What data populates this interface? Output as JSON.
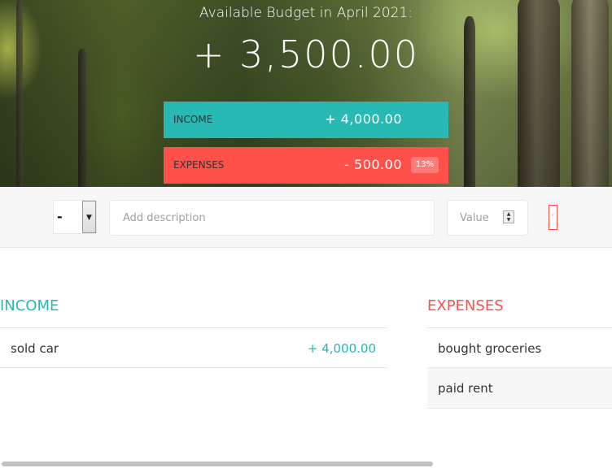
{
  "header": {
    "title": "Available Budget in April 2021:",
    "budget": "+ 3,500.00"
  },
  "summary": {
    "income": {
      "label": "Income",
      "value": "+ 4,000.00"
    },
    "expenses": {
      "label": "Expenses",
      "value": "- 500.00",
      "percentage": "13%"
    }
  },
  "add_form": {
    "type_selected": "-",
    "description_placeholder": "Add description",
    "value_placeholder": "Value",
    "add_button_icon": "check-icon"
  },
  "income": {
    "title": "Income",
    "items": [
      {
        "description": "sold car",
        "value": "+ 4,000.00"
      }
    ]
  },
  "expenses": {
    "title": "Expenses",
    "items": [
      {
        "description": "bought groceries"
      },
      {
        "description": "paid rent"
      }
    ]
  },
  "colors": {
    "income": "#28b9b5",
    "expenses": "#ff5049",
    "form_background": "#f7f7f7"
  }
}
